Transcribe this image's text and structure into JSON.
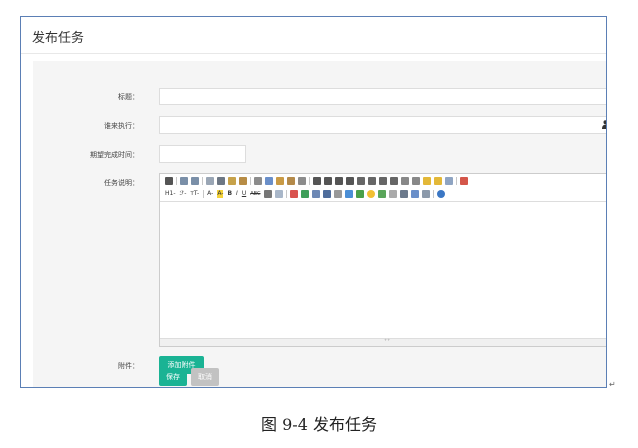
{
  "panel": {
    "title": "发布任务"
  },
  "form": {
    "title_label": "标题：",
    "executor_label": "谁来执行：",
    "deadline_label": "期望完成时间：",
    "desc_label": "任务说明：",
    "attachment_label": "附件：",
    "add_attachment_button": "添加附件",
    "save_button": "保存",
    "cancel_button": "取消"
  },
  "editor": {
    "heading_menu": "H1-",
    "font_family_menu": "ℱ-",
    "font_size_menu": "ᴛT-",
    "font_color_menu": "A-",
    "bg_color_menu": "A-",
    "bold": "B",
    "italic": "I",
    "underline": "U",
    "strike": "ABC",
    "resize_grip": "⁺⁺",
    "icons_row1": [
      "source-icon",
      "undo-icon",
      "redo-icon",
      "preview-icon",
      "print-icon",
      "template-icon",
      "cut-icon",
      "copy-icon",
      "paste-icon",
      "paste-text-icon",
      "paste-word-icon",
      "align-left-icon",
      "align-center-icon",
      "align-right-icon",
      "align-justify-icon",
      "ordered-list-icon",
      "unordered-list-icon",
      "indent-icon",
      "outdent-icon",
      "subscript-icon",
      "superscript-icon",
      "clear-format-icon",
      "quick-format-icon",
      "select-all-icon",
      "fullscreen-icon"
    ],
    "icons_row2": [
      "table-icon",
      "remove-format-icon",
      "image-icon",
      "flash-icon",
      "media-icon",
      "insert-file-icon",
      "code-icon",
      "emoticon-icon",
      "map-icon",
      "page-break-icon",
      "anchor-icon",
      "link-icon",
      "unlink-icon",
      "help-icon"
    ]
  },
  "caption": "图 9-4  发布任务",
  "colors": {
    "frame_border": "#5b7fb5",
    "accent": "#1ab394",
    "disabled": "#c2c2c2"
  }
}
